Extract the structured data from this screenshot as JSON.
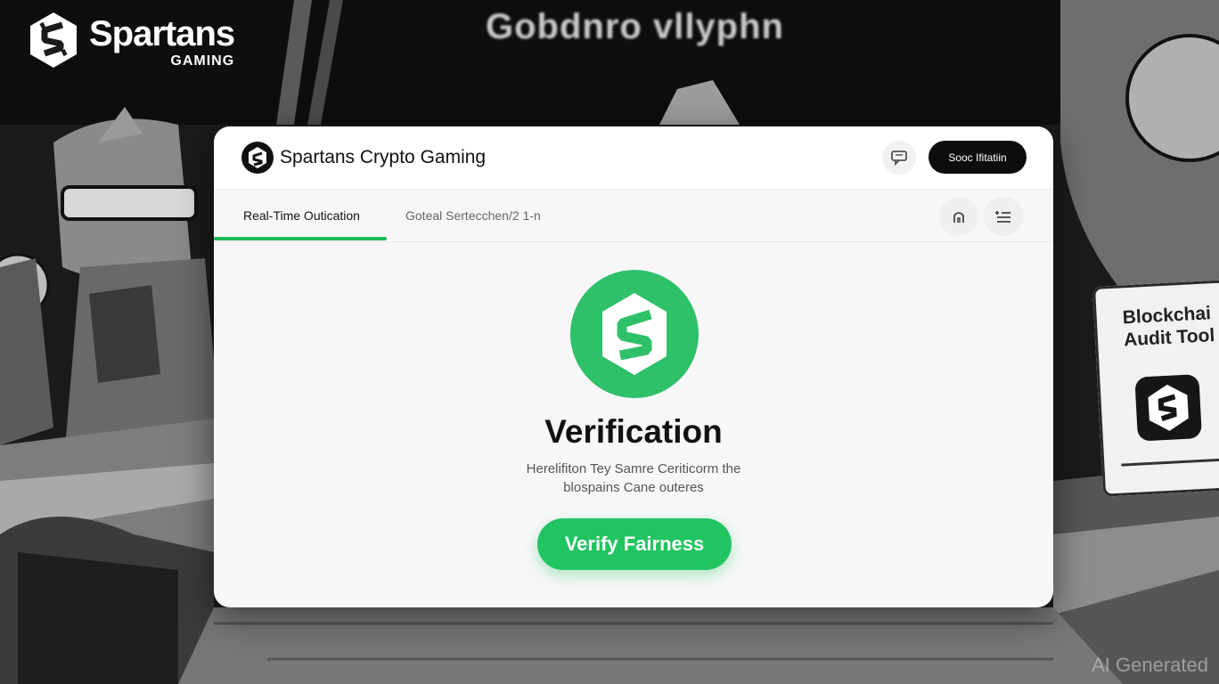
{
  "brand": {
    "name": "Spartans",
    "sub": "GAMING"
  },
  "background_banner": "Gobdnro vllyphn",
  "audit_sign": {
    "title": "Blockchai\nAudit Tool"
  },
  "watermark": "AI Generated",
  "app": {
    "title": "Spartans Crypto Gaming"
  },
  "header": {
    "cert_button": "Sooc Ifitatiin"
  },
  "tabs": [
    {
      "label": "Real-Time Outication",
      "active": true
    },
    {
      "label": "Goteal Sertecchen/2 1-n",
      "active": false
    }
  ],
  "main": {
    "heading": "Verification",
    "description_line1": "Herelifiton Tey Samre Ceriticorm the",
    "description_line2": "blospains Cane outeres",
    "verify_button": "Verify Fairness"
  },
  "colors": {
    "accent": "#21c461",
    "underline": "#1db955",
    "card": "#f7f7f8",
    "dark_button": "#0d0d0d"
  },
  "icons": [
    "spartans-logo-icon",
    "chat-icon",
    "home-icon",
    "list-icon"
  ]
}
